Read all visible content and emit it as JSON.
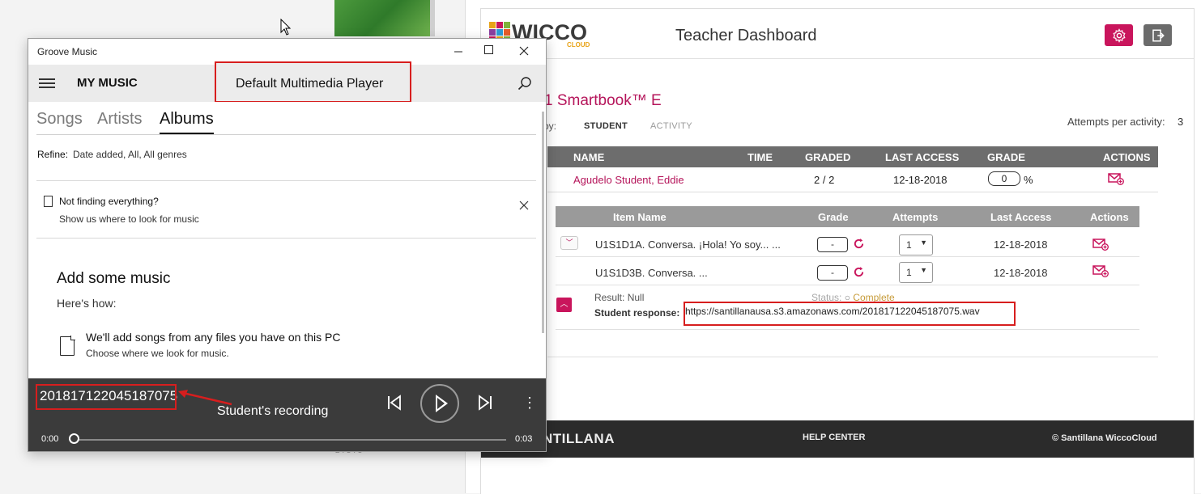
{
  "groove": {
    "app_title": "Groove Music",
    "nav_title": "MY MUSIC",
    "annotation_label": "Default Multimedia Player",
    "tabs": [
      {
        "label": "Songs"
      },
      {
        "label": "Artists"
      },
      {
        "label": "Albums"
      }
    ],
    "refine_label": "Refine:",
    "refine_value": "Date added, All, All genres",
    "notice_title": "Not finding everything?",
    "notice_body": "Show us where to look for music",
    "add_title": "Add some music",
    "add_subtitle": "Here's how:",
    "add_files_title": "We'll add songs from any files you have on this PC",
    "add_files_sub": "Choose where we look for music.",
    "player": {
      "track_title": "201817122045187075",
      "annotation": "Student's recording",
      "time_current": "0:00",
      "time_total": "0:03",
      "progress": 0.0
    }
  },
  "wicco": {
    "logo_text": "WICCO",
    "logo_sub": "CLOUD",
    "page_title": "Teacher Dashboard",
    "book_title": "1 Smartbook™ E",
    "by_label": "by:",
    "tabs": {
      "student": "STUDENT",
      "activity": "ACTIVITY"
    },
    "attempts_label": "Attempts per activity:",
    "attempts_value": "3",
    "table": {
      "headers": [
        "NAME",
        "TIME",
        "GRADED",
        "LAST ACCESS",
        "GRADE",
        "ACTIONS"
      ],
      "row": {
        "name": "Agudelo Student, Eddie",
        "time": "",
        "graded": "2 / 2",
        "last_access": "12-18-2018",
        "grade": "0",
        "grade_unit": "%"
      }
    },
    "subtable": {
      "headers": [
        "Item Name",
        "Grade",
        "Attempts",
        "Last Access",
        "Actions"
      ],
      "rows": [
        {
          "item": "U1S1D1A. Conversa. ¡Hola! Yo soy... ...",
          "grade": "-",
          "attempts": "1",
          "last_access": "12-18-2018"
        },
        {
          "item": "U1S1D3B. Conversa. ...",
          "grade": "-",
          "attempts": "1",
          "last_access": "12-18-2018"
        }
      ],
      "detail": {
        "result_label": "Result:",
        "result_value": "Null",
        "status_label": "Status:",
        "status_value": "Complete",
        "response_label": "Student response:",
        "response_url": "https://santillanausa.s3.amazonaws.com/201817122045187075.wav"
      }
    },
    "footer": {
      "brand": "NTILLANA",
      "help": "HELP CENTER",
      "copyright": "© Santillana WiccoCloud"
    }
  },
  "colors": {
    "magenta": "#c9155c",
    "annotation_red": "#d71e1e",
    "player_bg": "#3b3b3b",
    "table_header": "#6d6d6d"
  }
}
